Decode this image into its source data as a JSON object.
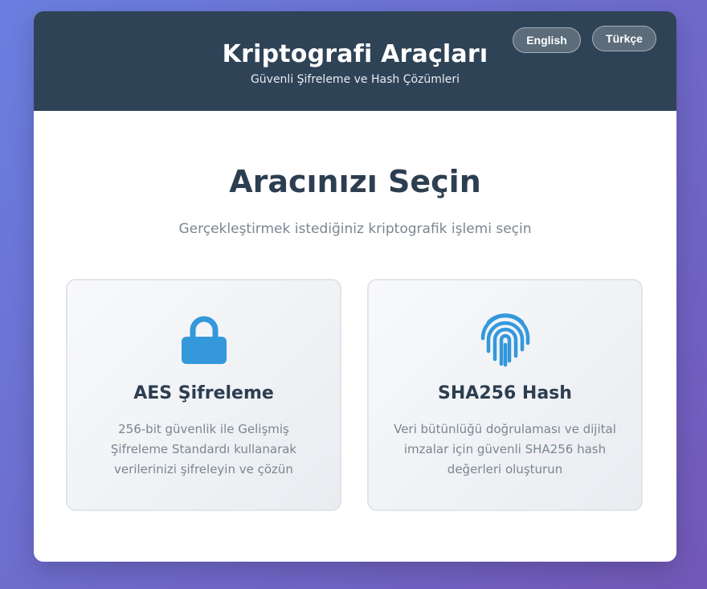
{
  "header": {
    "title": "Kriptografi Araçları",
    "subtitle": "Güvenli Şifreleme ve Hash Çözümleri",
    "languages": [
      {
        "label": "English"
      },
      {
        "label": "Türkçe"
      }
    ]
  },
  "main": {
    "title": "Aracınızı Seçin",
    "subtitle": "Gerçekleştirmek istediğiniz kriptografik işlemi seçin",
    "tools": [
      {
        "icon": "lock-icon",
        "title": "AES Şifreleme",
        "description": "256-bit güvenlik ile Gelişmiş Şifreleme Standardı kullanarak verilerinizi şifreleyin ve çözün"
      },
      {
        "icon": "fingerprint-icon",
        "title": "SHA256 Hash",
        "description": "Veri bütünlüğü doğrulaması ve dijital imzalar için güvenli SHA256 hash değerleri oluşturun"
      }
    ]
  },
  "colors": {
    "header_bg": "#2f4357",
    "icon_blue": "#3498db",
    "title_text": "#2c3e50",
    "muted_text": "#7a8691"
  }
}
